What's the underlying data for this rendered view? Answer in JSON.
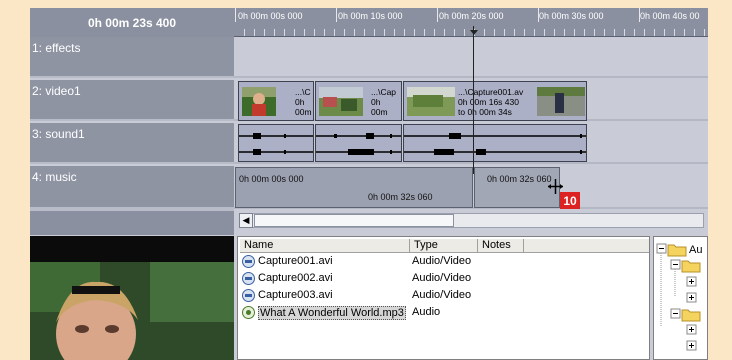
{
  "timeline": {
    "current_time": "0h 00m 23s 400",
    "ruler_labels": [
      "0h 00m 00s 000",
      "0h 00m 10s 000",
      "0h 00m 20s 000",
      "0h 00m 30s 000",
      "0h 00m 40s 00"
    ]
  },
  "tracks": [
    {
      "label": "1: effects"
    },
    {
      "label": "2: video1"
    },
    {
      "label": "3: sound1"
    },
    {
      "label": "4: music"
    }
  ],
  "video_clips": [
    {
      "text": [
        "...\\C",
        "0h",
        "00m"
      ]
    },
    {
      "text": [
        "...\\Cap",
        "0h",
        "00m"
      ]
    },
    {
      "text": [
        "...\\Capture001.av",
        "0h 00m 16s 430",
        "to 0h 00m 34s"
      ]
    }
  ],
  "music_clips": [
    {
      "start": "0h 00m 00s 000",
      "duration": "0h 00m 32s 060"
    },
    {
      "end": "0h 00m 32s 060"
    }
  ],
  "drag_badge": "10",
  "media": {
    "columns": [
      "Name",
      "Type",
      "Notes"
    ],
    "rows": [
      {
        "name": "Capture001.avi",
        "type": "Audio/Video",
        "icon": "video-file-icon"
      },
      {
        "name": "Capture002.avi",
        "type": "Audio/Video",
        "icon": "video-file-icon"
      },
      {
        "name": "Capture003.avi",
        "type": "Audio/Video",
        "icon": "video-file-icon"
      },
      {
        "name": "What A Wonderful World.mp3",
        "type": "Audio",
        "icon": "audio-file-icon"
      }
    ]
  },
  "folder_tree": {
    "root_label": "Au"
  }
}
